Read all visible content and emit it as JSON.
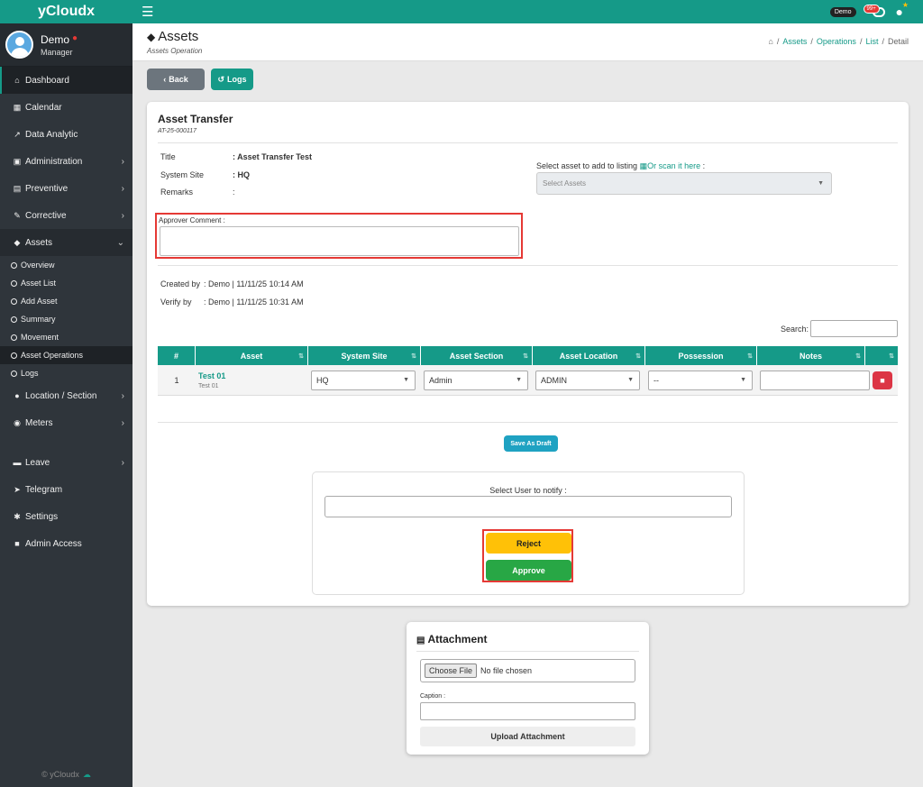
{
  "brand": "yCloudx",
  "user": {
    "name": "Demo",
    "role": "Manager"
  },
  "topbar": {
    "demo_badge": "Demo",
    "notif_count": "99+"
  },
  "sidebar": {
    "items": [
      {
        "label": "Dashboard"
      },
      {
        "label": "Calendar"
      },
      {
        "label": "Data Analytic"
      },
      {
        "label": "Administration"
      },
      {
        "label": "Preventive"
      },
      {
        "label": "Corrective"
      },
      {
        "label": "Assets"
      },
      {
        "label": "Location / Section"
      },
      {
        "label": "Meters"
      },
      {
        "label": "Leave"
      },
      {
        "label": "Telegram"
      },
      {
        "label": "Settings"
      },
      {
        "label": "Admin Access"
      }
    ],
    "sub_items": [
      {
        "label": "Overview"
      },
      {
        "label": "Asset List"
      },
      {
        "label": "Add Asset"
      },
      {
        "label": "Summary"
      },
      {
        "label": "Movement"
      },
      {
        "label": "Asset Operations"
      },
      {
        "label": "Logs"
      }
    ],
    "footer": "© yCloudx"
  },
  "header": {
    "title": "Assets",
    "subtitle": "Assets Operation",
    "breadcrumb": [
      "Assets",
      "Operations",
      "List",
      "Detail"
    ]
  },
  "actions": {
    "back": "Back",
    "logs": "Logs"
  },
  "card": {
    "title": "Asset Transfer",
    "code": "AT-25-000117",
    "title_label": "Title",
    "title_value": ": Asset Transfer Test",
    "site_label": "System Site",
    "site_value": ": HQ",
    "remarks_label": "Remarks",
    "remarks_value": ":",
    "select_asset_label": "Select asset to add to listing",
    "scan_link": "Or scan it here",
    "select_asset_suffix": " :",
    "select_assets_placeholder": "Select Assets",
    "approver_comment_label": "Approver Comment :",
    "created_by_label": "Created by",
    "created_by_value": ":   Demo | 11/11/25 10:14 AM",
    "verify_by_label": "Verify by",
    "verify_by_value": ":   Demo | 11/11/25 10:31 AM",
    "search_label": "Search:",
    "save_draft": "Save As Draft",
    "notify_label": "Select User to notify :",
    "reject": "Reject",
    "approve": "Approve"
  },
  "table": {
    "headers": [
      "#",
      "Asset",
      "System Site",
      "Asset Section",
      "Asset Location",
      "Possession",
      "Notes",
      ""
    ],
    "rows": [
      {
        "num": "1",
        "asset": "Test 01",
        "asset_sub": "Test 01",
        "site": "HQ",
        "section": "Admin",
        "location": "ADMIN",
        "possession": "--"
      }
    ]
  },
  "attachment": {
    "title": "Attachment",
    "choose": "Choose File",
    "no_file": "No file chosen",
    "caption_label": "Caption :",
    "upload": "Upload Attachment"
  },
  "colors": {
    "primary": "#159a88",
    "sidebar": "#2f353b",
    "danger": "#dc3545",
    "warning": "#ffc107",
    "success": "#28a745"
  }
}
